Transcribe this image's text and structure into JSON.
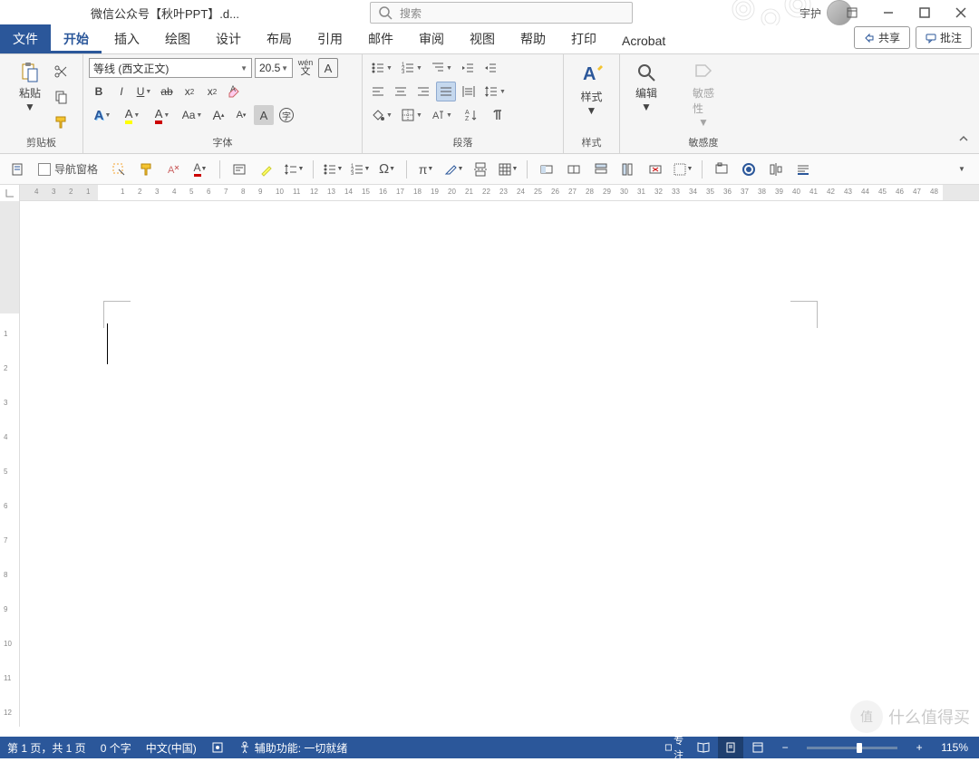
{
  "title": "微信公众号【秋叶PPT】.d...",
  "search": {
    "placeholder": "搜索"
  },
  "user": {
    "name": "宇护"
  },
  "tabs": {
    "file": "文件",
    "items": [
      "开始",
      "插入",
      "绘图",
      "设计",
      "布局",
      "引用",
      "邮件",
      "审阅",
      "视图",
      "帮助",
      "打印",
      "Acrobat"
    ],
    "active": 0,
    "share": "共享",
    "comments": "批注"
  },
  "ribbon": {
    "clipboard": {
      "label": "剪贴板",
      "paste": "粘贴"
    },
    "font": {
      "label": "字体",
      "fontname": "等线 (西文正文)",
      "fontsize": "20.5",
      "pinyin": "wén"
    },
    "paragraph": {
      "label": "段落"
    },
    "styles": {
      "label": "样式",
      "btn": "样式"
    },
    "editing": {
      "label": "",
      "btn": "编辑"
    },
    "sensitivity": {
      "label": "敏感度",
      "btn": "敏感\n性"
    }
  },
  "toolbar2": {
    "navpane": "导航窗格"
  },
  "statusbar": {
    "page": "第 1 页，共 1 页",
    "words": "0 个字",
    "lang": "中文(中国)",
    "a11y": "辅助功能: 一切就绪",
    "focus": "专注",
    "zoom": "115%"
  },
  "watermark": "什么值得买"
}
